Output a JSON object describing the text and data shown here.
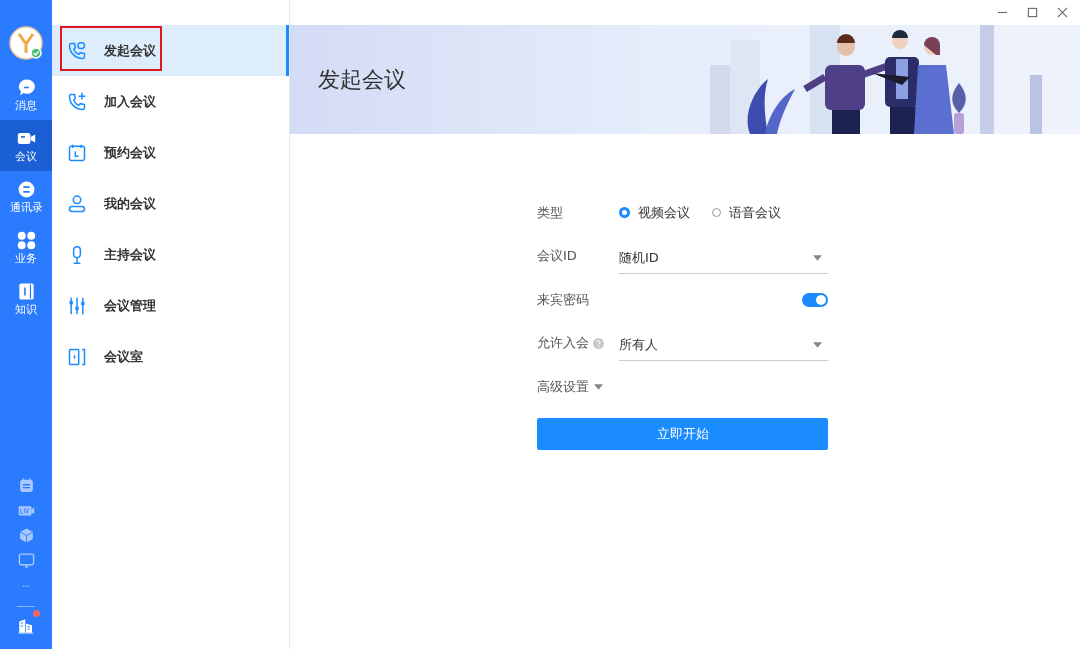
{
  "rail": {
    "items": [
      {
        "label": "消息",
        "kind": "chat",
        "selected": false
      },
      {
        "label": "会议",
        "kind": "video",
        "selected": true
      },
      {
        "label": "通讯录",
        "kind": "contacts",
        "selected": false
      },
      {
        "label": "业务",
        "kind": "apps",
        "selected": false
      },
      {
        "label": "知识",
        "kind": "book",
        "selected": false
      }
    ],
    "tools": [
      {
        "kind": "calendar"
      },
      {
        "kind": "live"
      },
      {
        "kind": "cube"
      },
      {
        "kind": "screen"
      },
      {
        "kind": "more"
      }
    ],
    "org": {
      "has_badge": true
    }
  },
  "menu": {
    "items": [
      {
        "label": "发起会议",
        "kind": "call-start",
        "selected": true,
        "annotated": true
      },
      {
        "label": "加入会议",
        "kind": "call-add",
        "selected": false,
        "annotated": false
      },
      {
        "label": "预约会议",
        "kind": "calendar",
        "selected": false,
        "annotated": false
      },
      {
        "label": "我的会议",
        "kind": "person",
        "selected": false,
        "annotated": false
      },
      {
        "label": "主持会议",
        "kind": "mic",
        "selected": false,
        "annotated": false
      },
      {
        "label": "会议管理",
        "kind": "sliders",
        "selected": false,
        "annotated": false
      },
      {
        "label": "会议室",
        "kind": "door",
        "selected": false,
        "annotated": false
      }
    ]
  },
  "banner": {
    "title": "发起会议"
  },
  "form": {
    "type": {
      "label": "类型",
      "options": [
        {
          "label": "视频会议",
          "selected": true
        },
        {
          "label": "语音会议",
          "selected": false
        }
      ]
    },
    "meeting_id": {
      "label": "会议ID",
      "value": "随机ID"
    },
    "guest_password": {
      "label": "来宾密码",
      "on": true
    },
    "admission": {
      "label": "允许入会",
      "value": "所有人"
    },
    "advanced": {
      "label": "高级设置",
      "expanded": false
    },
    "start_button": "立即开始"
  }
}
